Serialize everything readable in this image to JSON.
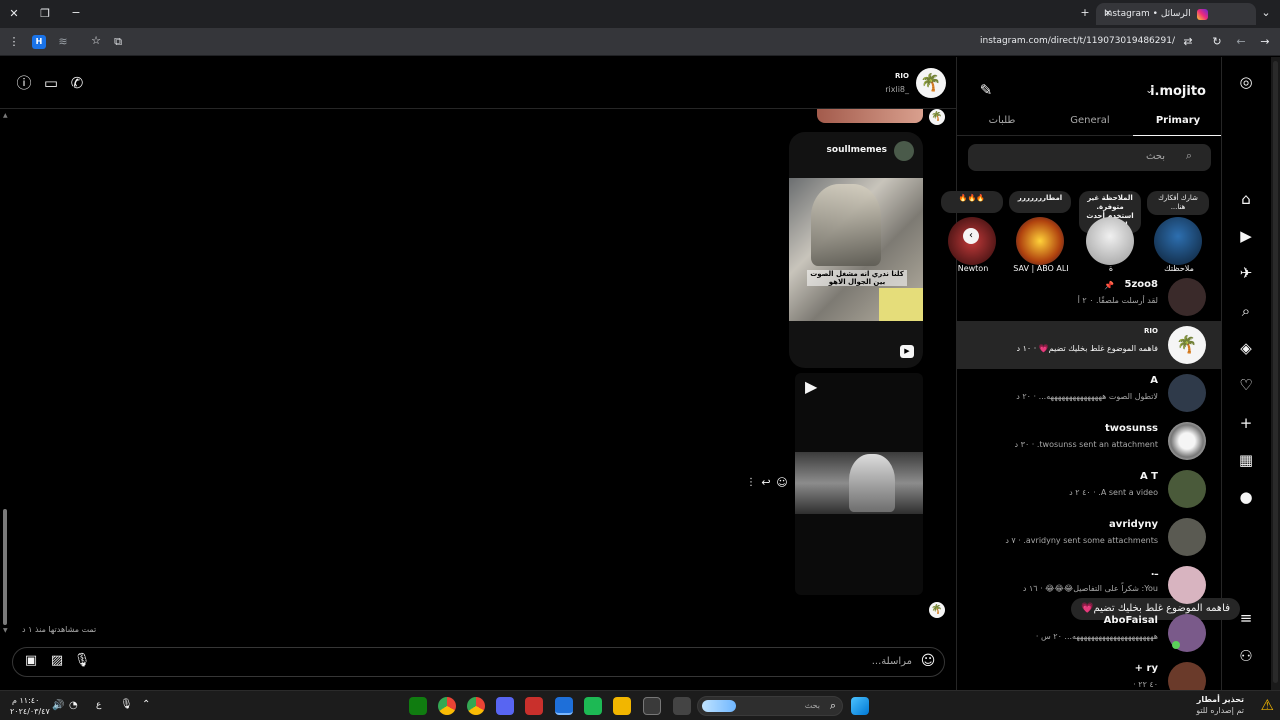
{
  "browser": {
    "tab_title": "الرسائل • Instagram",
    "url": "instagram.com/direct/t/119073019486291/",
    "new_tab": "+",
    "close_tab": "✕",
    "back": "→",
    "forward": "←",
    "reload": "↻",
    "menu": "⋮",
    "profile_badge": "H"
  },
  "chat": {
    "header_name": "RIO",
    "header_username": "rixli8_",
    "shared_post_author": "soullmemes",
    "shared_post_caption": "كلنا ندري انه مشغل الصوت بين الجوال الاهو",
    "last_message": "فاهمه الموضوع غلط بخليك تضيم💗",
    "seen_status": "تمت مشاهدتها منذ ١ د",
    "composer_placeholder": "مراسلة..."
  },
  "inbox": {
    "account": "i.mojito",
    "tabs": [
      {
        "label": "Primary"
      },
      {
        "label": "General"
      },
      {
        "label": "طلبات"
      }
    ],
    "search_placeholder": "بحث",
    "notes": [
      {
        "bubble": "شارك أفكارك هنا...",
        "name": "ملاحظتك"
      },
      {
        "bubble": "الملاحظة غير متوفرة. استخدم أحدث إصدار م...",
        "name": "ة"
      },
      {
        "bubble": "امطاررررررر",
        "name": "SAV | ABO ALI"
      },
      {
        "bubble": "🔥🔥🔥",
        "name": "Newton"
      }
    ],
    "conversations": [
      {
        "name": "5zoo8",
        "preview": "لقد أرسلت ملصقًا. ٠ ٢ أ",
        "selected": false,
        "avatar_color": "#3a2a2a"
      },
      {
        "name": "RIO",
        "preview": "فاهمه الموضوع غلط بخليك تضيم💗 · ١٠ د",
        "selected": true,
        "avatar_color": "#f5f5f5"
      },
      {
        "name": "A",
        "preview": "لاتطول الصوت هههههههههههههههه... · ٢٠ د",
        "selected": false,
        "avatar_color": "#2f3a4a"
      },
      {
        "name": "twosunss",
        "preview": "twosunss sent an attachment. · ٣٠ د",
        "selected": false,
        "avatar_color": "#d9d9d9"
      },
      {
        "name": "A T",
        "preview": "A sent a video. · ٤٠ ٢ د",
        "selected": false,
        "avatar_color": "#4a5a3a"
      },
      {
        "name": "avridyny",
        "preview": "avridyny sent some attachments. · ٧ د",
        "selected": false,
        "avatar_color": "#5a5a52"
      },
      {
        "name": "ـ.",
        "preview": "You: شكراً على التفاصيل😂😂😂 · ١٦ د",
        "selected": false,
        "avatar_color": "#d8b4c0"
      },
      {
        "name": "AboFaisal",
        "preview": "ههههههههههههههههههههههه... ٢٠ س ·",
        "selected": false,
        "avatar_color": "#7a5a8a"
      },
      {
        "name": "ry +",
        "preview": "٤٠ ٢٢ ·",
        "selected": false,
        "avatar_color": "#6a3a2a"
      }
    ]
  },
  "taskbar": {
    "search_placeholder": "بحث",
    "time": "١١:٤٠ م",
    "date": "٢٠٢٤/٠٣/٤٧",
    "lang": "ع",
    "notification_title": "تحذير أمطار",
    "notification_sub": "تم إصداره للتو"
  }
}
